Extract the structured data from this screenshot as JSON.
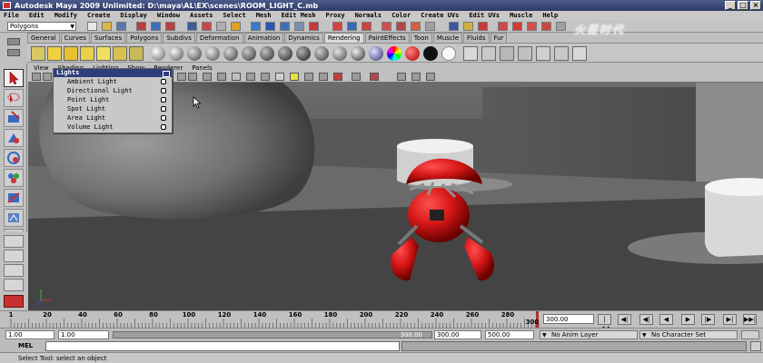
{
  "window": {
    "title": "Autodesk Maya 2009 Unlimited: D:\\maya\\AL\\EX\\scenes\\ROOM_LIGHT_C.mb",
    "minimize": "_",
    "maximize": "□",
    "close": "×"
  },
  "menubar": [
    "File",
    "Edit",
    "Modify",
    "Create",
    "Display",
    "Window",
    "Assets",
    "Select",
    "Mesh",
    "Edit Mesh",
    "Proxy",
    "Normals",
    "Color",
    "Create UVs",
    "Edit UVs",
    "Muscle",
    "Help"
  ],
  "statusline": {
    "mode": "Polygons"
  },
  "shelf": {
    "tabs": [
      "General",
      "Curves",
      "Surfaces",
      "Polygons",
      "Subdivs",
      "Deformation",
      "Animation",
      "Dynamics",
      "Rendering",
      "PaintEffects",
      "Toon",
      "Muscle",
      "Fluids",
      "Fur"
    ],
    "active_tab": "Rendering"
  },
  "panel": {
    "menus": [
      "View",
      "Shading",
      "Lighting",
      "Show",
      "Renderer",
      "Panels"
    ]
  },
  "lights_menu": {
    "title": "Lights",
    "items": [
      "Ambient Light",
      "Directional Light",
      "Point Light",
      "Spot Light",
      "Area Light",
      "Volume Light"
    ]
  },
  "timeslider": {
    "ticks": [
      "1",
      "20",
      "40",
      "60",
      "80",
      "100",
      "120",
      "140",
      "160",
      "180",
      "200",
      "220",
      "240",
      "260",
      "280",
      "300"
    ],
    "current_time": "300.00",
    "end_label": "300"
  },
  "playback": [
    "|◀◀",
    "◀|",
    "◀|",
    "◀",
    "▶",
    "|▶",
    "▶|",
    "▶▶|"
  ],
  "rangeslider": {
    "start_time": "1.00",
    "playback_start": "1.00",
    "range_label": "300.00",
    "playback_end": "300.00",
    "end_time": "500.00",
    "anim_layer": "No Anim Layer",
    "character_set": "No Character Set"
  },
  "commandline": {
    "label": "MEL"
  },
  "helpline": {
    "text": "Select Tool: select an object"
  },
  "watermark": "火星时代"
}
